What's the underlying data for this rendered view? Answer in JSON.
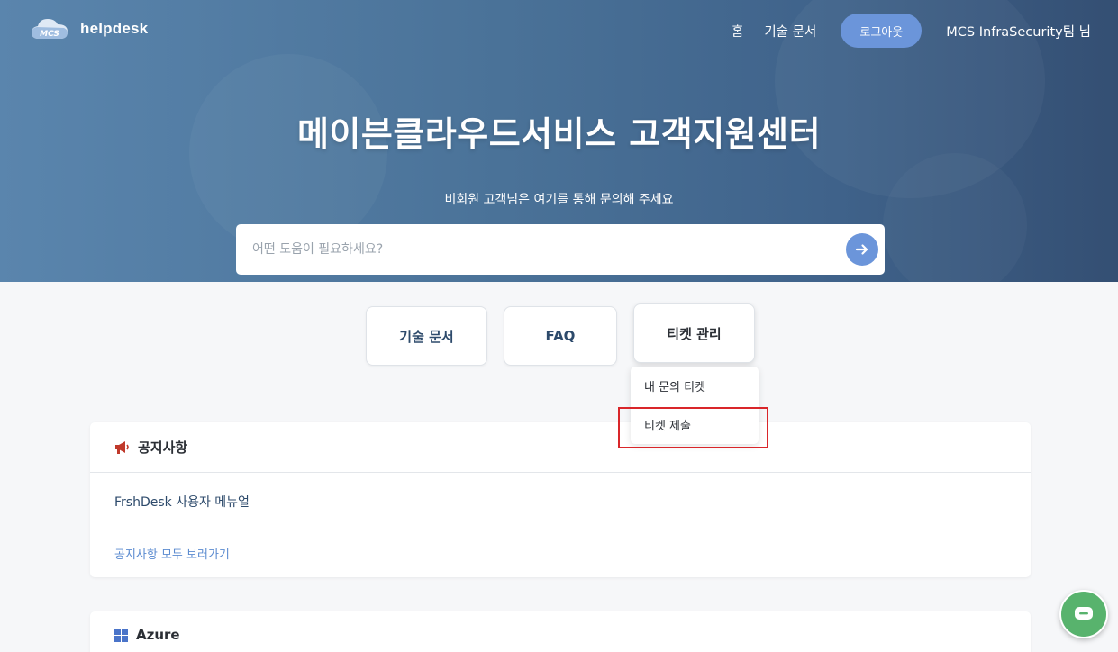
{
  "header": {
    "logo_text": "MCS",
    "brand": "helpdesk",
    "nav_home": "홈",
    "nav_docs": "기술 문서",
    "logout_label": "로그아웃",
    "user_name": "MCS InfraSecurity팀 님"
  },
  "hero": {
    "title": "메이븐클라우드서비스 고객지원센터",
    "subtitle": "비회원 고객님은 여기를 통해 문의해 주세요",
    "search_placeholder": "어떤 도움이 필요하세요?",
    "search_icon": "arrow-right-icon"
  },
  "cards": {
    "docs": "기술 문서",
    "faq": "FAQ",
    "ticket": "티켓 관리"
  },
  "ticket_menu": {
    "items": [
      "내 문의 티켓",
      "티켓 제출"
    ]
  },
  "notice": {
    "icon": "megaphone-icon",
    "title": "공지사항",
    "items": [
      "FrshDesk 사용자 메뉴얼"
    ],
    "more": "공지사항 모두 보러가기"
  },
  "azure": {
    "icon": "windows-icon",
    "title": "Azure"
  },
  "chat": {
    "icon": "chat-bubble-icon"
  },
  "colors": {
    "accent": "#6b95da",
    "highlight": "#d9262a",
    "chat": "#58b36d"
  }
}
